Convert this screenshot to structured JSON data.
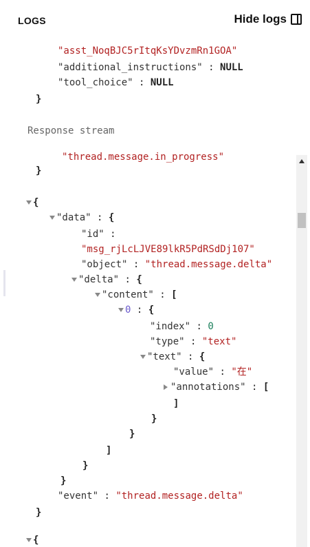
{
  "header": {
    "title": "LOGS",
    "hide_label": "Hide logs",
    "icon": "panel-right-icon"
  },
  "request_tail": {
    "assistant_id_value": "\"asst_NoqBJC5rItqKsYDvzmRn1GOA\"",
    "additional_instructions_key": "\"additional_instructions\"",
    "tool_choice_key": "\"tool_choice\"",
    "null": "NULL",
    "close": "}"
  },
  "response_stream": {
    "label": "Response stream",
    "event_value_top": "\"thread.message.in_progress\"",
    "data_key": "\"data\"",
    "id_key": "\"id\"",
    "id_value": "\"msg_rjLcLJVE89lkR5PdRSdDj107\"",
    "object_key": "\"object\"",
    "object_value": "\"thread.message.delta\"",
    "delta_key": "\"delta\"",
    "content_key": "\"content\"",
    "index_zero": "0",
    "index_key": "\"index\"",
    "index_value": "0",
    "type_key": "\"type\"",
    "type_value": "\"text\"",
    "text_key": "\"text\"",
    "value_key": "\"value\"",
    "value_value": "\"在\"",
    "annotations_key": "\"annotations\"",
    "event_key": "\"event\"",
    "event_value": "\"thread.message.delta\""
  },
  "symbols": {
    "open_brace": "{",
    "close_brace": "}",
    "open_bracket": "[",
    "close_bracket": "]",
    "colon": " : "
  }
}
